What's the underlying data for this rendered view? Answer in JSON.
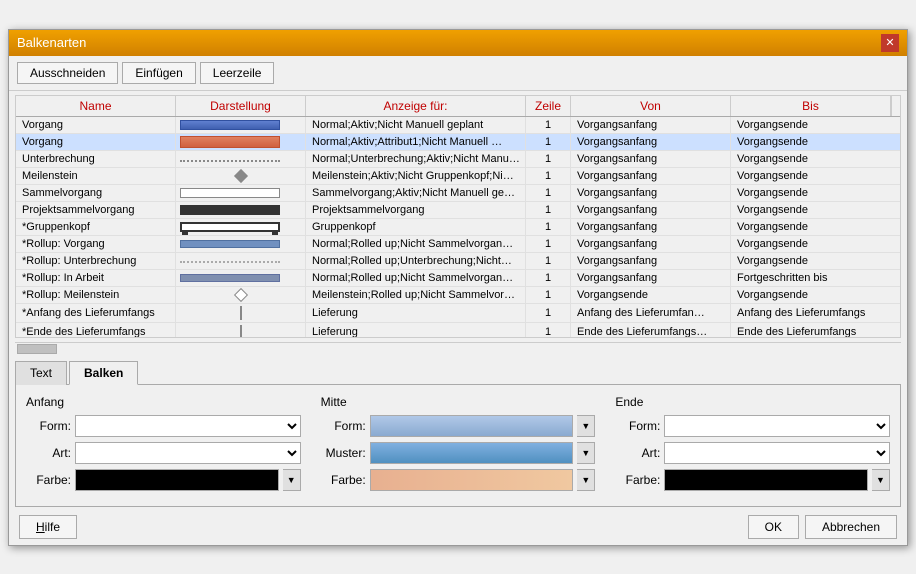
{
  "dialog": {
    "title": "Balkenarten",
    "close_label": "✕"
  },
  "toolbar": {
    "cut_label": "Ausschneiden",
    "paste_label": "Einfügen",
    "empty_row_label": "Leerzeile"
  },
  "table": {
    "headers": [
      "Name",
      "Darstellung",
      "Anzeige für:",
      "Zeile",
      "Von",
      "Bis"
    ],
    "rows": [
      {
        "name": "Vorgang",
        "bar_type": "blue",
        "display": "Normal;Aktiv;Nicht Manuell geplant",
        "zeile": "1",
        "von": "Vorgangsanfang",
        "bis": "Vorgangsende"
      },
      {
        "name": "Vorgang",
        "bar_type": "orange",
        "display": "Normal;Aktiv;Attribut1;Nicht Manuell …",
        "zeile": "1",
        "von": "Vorgangsanfang",
        "bis": "Vorgangsende"
      },
      {
        "name": "Unterbrechung",
        "bar_type": "dotted",
        "display": "Normal;Unterbrechung;Aktiv;Nicht Manu…",
        "zeile": "1",
        "von": "Vorgangsanfang",
        "bis": "Vorgangsende"
      },
      {
        "name": "Meilenstein",
        "bar_type": "diamond",
        "display": "Meilenstein;Aktiv;Nicht Gruppenkopf;Ni…",
        "zeile": "1",
        "von": "Vorgangsanfang",
        "bis": "Vorgangsende"
      },
      {
        "name": "Sammelvorgang",
        "bar_type": "sammel",
        "display": "Sammelvorgang;Aktiv;Nicht Manuell ge…",
        "zeile": "1",
        "von": "Vorgangsanfang",
        "bis": "Vorgangsende"
      },
      {
        "name": "Projektsammelvorgang",
        "bar_type": "projekt",
        "display": "Projektsammelvorgang",
        "zeile": "1",
        "von": "Vorgangsanfang",
        "bis": "Vorgangsende"
      },
      {
        "name": "*Gruppenkopf",
        "bar_type": "gruppe",
        "display": "Gruppenkopf",
        "zeile": "1",
        "von": "Vorgangsanfang",
        "bis": "Vorgangsende"
      },
      {
        "name": "*Rollup: Vorgang",
        "bar_type": "rollup_blue",
        "display": "Normal;Rolled up;Nicht Sammelvorgan…",
        "zeile": "1",
        "von": "Vorgangsanfang",
        "bis": "Vorgangsende"
      },
      {
        "name": "*Rollup: Unterbrechung",
        "bar_type": "rollup_dotted",
        "display": "Normal;Rolled up;Unterbrechung;Nicht…",
        "zeile": "1",
        "von": "Vorgangsanfang",
        "bis": "Vorgangsende"
      },
      {
        "name": "*Rollup: In Arbeit",
        "bar_type": "rollup_normal",
        "display": "Normal;Rolled up;Nicht Sammelvorgan…",
        "zeile": "1",
        "von": "Vorgangsanfang",
        "bis": "Fortgeschritten bis"
      },
      {
        "name": "*Rollup: Meilenstein",
        "bar_type": "diamond_outline",
        "display": "Meilenstein;Rolled up;Nicht Sammelvor…",
        "zeile": "1",
        "von": "Vorgangsende",
        "bis": "Vorgangsende"
      },
      {
        "name": "*Anfang des Lieferumfangs",
        "bar_type": "pipe",
        "display": "Lieferung",
        "zeile": "1",
        "von": "Anfang des Lieferumfan…",
        "bis": "Anfang des Lieferumfangs"
      },
      {
        "name": "*Ende des Lieferumfangs",
        "bar_type": "pipe_end",
        "display": "Lieferung",
        "zeile": "1",
        "von": "Ende des Lieferumfangs…",
        "bis": "Ende des Lieferumfangs"
      }
    ]
  },
  "tabs": {
    "text_label": "Text",
    "balken_label": "Balken"
  },
  "balken_form": {
    "anfang_title": "Anfang",
    "mitte_title": "Mitte",
    "ende_title": "Ende",
    "form_label": "Form:",
    "art_label": "Art:",
    "farbe_label": "Farbe:",
    "muster_label": "Muster:"
  },
  "bottom": {
    "help_label": "Hilfe",
    "ok_label": "OK",
    "cancel_label": "Abbrechen"
  }
}
